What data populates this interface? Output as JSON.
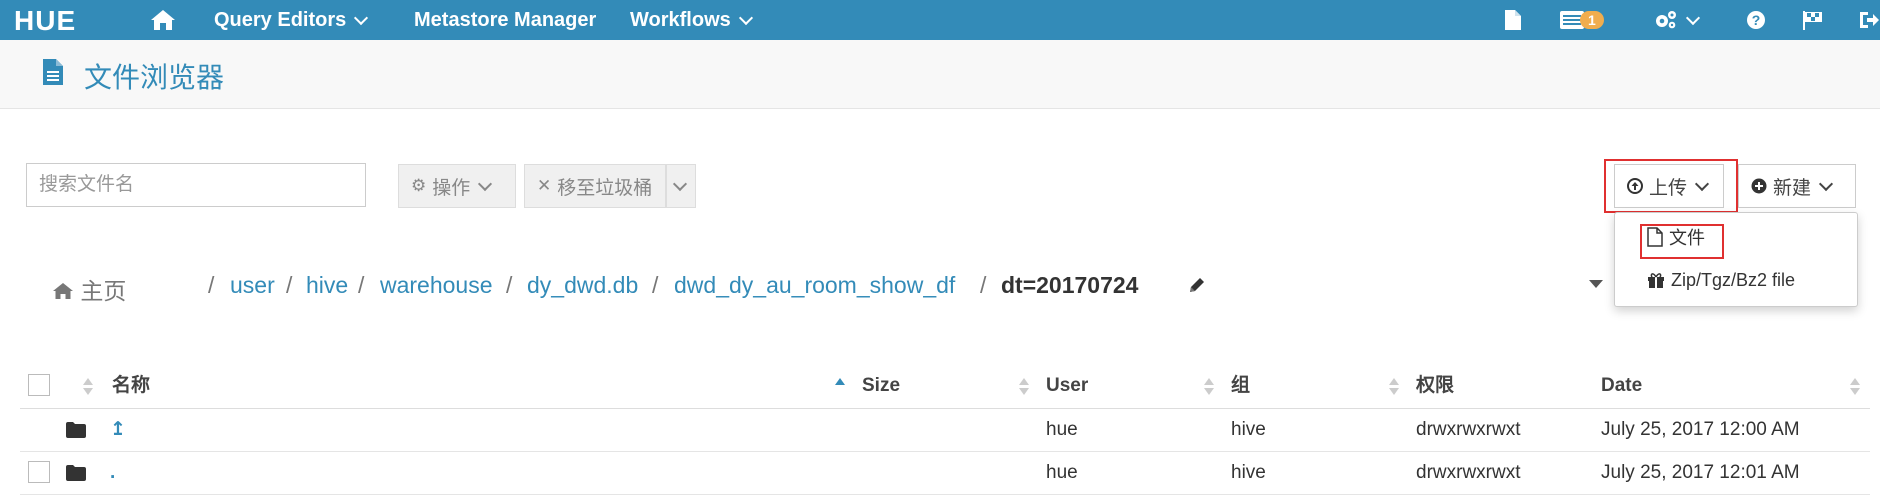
{
  "nav": {
    "logo": "HUE",
    "items": [
      {
        "label": "Query Editors"
      },
      {
        "label": "Metastore Manager"
      },
      {
        "label": "Workflows"
      }
    ],
    "jobs_badge": "1"
  },
  "page": {
    "title": "文件浏览器"
  },
  "toolbar": {
    "search_placeholder": "搜索文件名",
    "actions_label": "操作",
    "trash_label": "移至垃圾桶",
    "upload_label": "上传",
    "new_label": "新建"
  },
  "upload_menu": {
    "items": [
      {
        "label": "文件"
      },
      {
        "label": "Zip/Tgz/Bz2 file"
      }
    ]
  },
  "breadcrumb": {
    "home": "主页",
    "parts": [
      "user",
      "hive",
      "warehouse",
      "dy_dwd.db",
      "dwd_dy_au_room_show_df"
    ],
    "current": "dt=20170724",
    "separator": "/"
  },
  "table": {
    "columns": [
      "名称",
      "Size",
      "User",
      "组",
      "权限",
      "Date"
    ],
    "rows": [
      {
        "name": "↥",
        "size": "",
        "user": "hue",
        "group": "hive",
        "perm": "drwxrwxrwxt",
        "date": "July 25, 2017 12:00 AM"
      },
      {
        "name": ".",
        "size": "",
        "user": "hue",
        "group": "hive",
        "perm": "drwxrwxrwxt",
        "date": "July 25, 2017 12:01 AM"
      }
    ]
  },
  "colors": {
    "primary": "#338bb8",
    "highlight": "#e03030",
    "badge": "#f0ad4e"
  }
}
